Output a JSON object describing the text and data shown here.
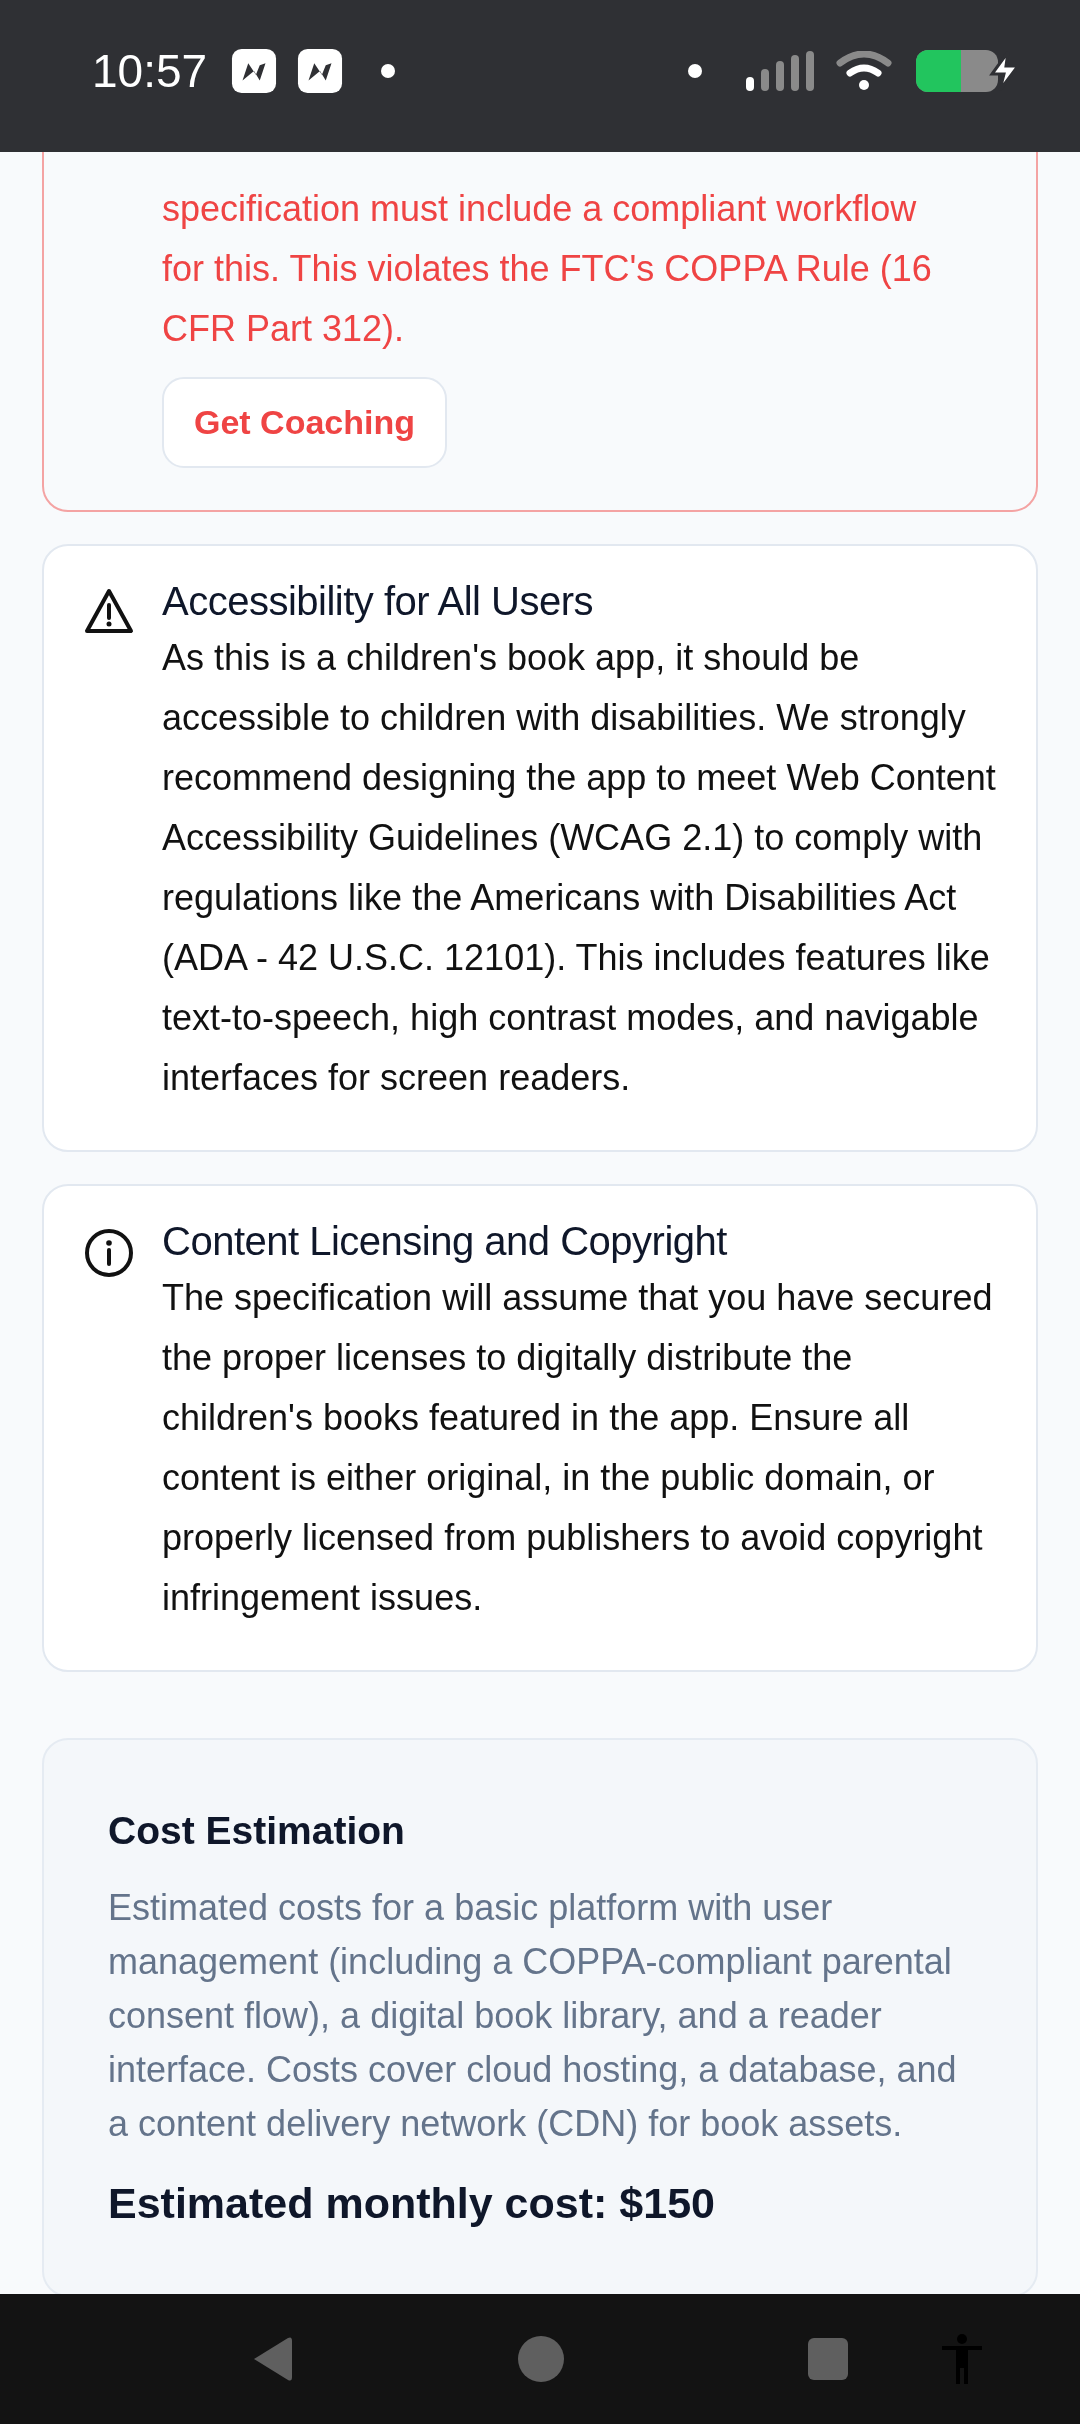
{
  "status_bar": {
    "time": "10:57"
  },
  "alerts": [
    {
      "kind": "error",
      "body": [
        "specification must include a compliant workflow",
        "for this. This violates the FTC's COPPA Rule (16",
        "CFR Part 312)."
      ],
      "button": "Get Coaching"
    },
    {
      "kind": "warning",
      "title": "Accessibility for All Users",
      "body": [
        "As this is a children's book app, it should be accessible to children with disabilities. We strongly recommend designing the app to meet Web Content Accessibility Guidelines (WCAG 2.1) to comply with regulations like the Americans with Disabilities Act (ADA - 42 U.S.C. 12101). This includes features like text-to-speech, high contrast modes, and navigable interfaces for screen readers."
      ]
    },
    {
      "kind": "info",
      "title": "Content Licensing and Copyright",
      "body": [
        "The specification will assume that you have secured the proper licenses to digitally distribute the children's books featured in the app. Ensure all content is either original, in the public domain, or properly licensed from publishers to avoid copyright infringement issues."
      ]
    }
  ],
  "cost": {
    "title": "Cost Estimation",
    "description": "Estimated costs for a basic platform with user management (including a COPPA-compliant parental consent flow), a digital book library, and a reader interface. Costs cover cloud hosting, a database, and a content delivery network (CDN) for book assets.",
    "monthly": "Estimated monthly cost: $150"
  }
}
